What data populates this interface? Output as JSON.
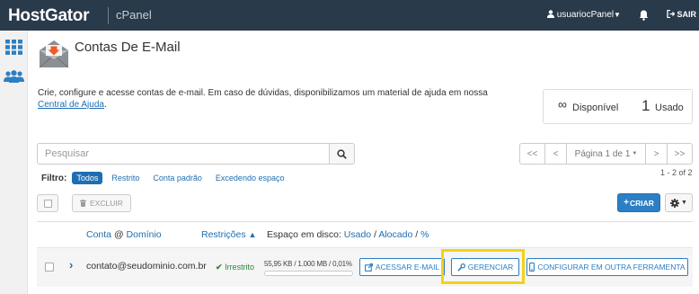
{
  "header": {
    "brand": "HostGator",
    "product": "cPanel",
    "username": "usuariocPanel",
    "logout_label": "SAIR"
  },
  "page": {
    "title": "Contas De E-Mail",
    "description": "Crie, configure e acesse contas de e-mail. Em caso de dúvidas, disponibilizamos um material de ajuda em nossa",
    "help_link": "Central de Ajuda",
    "help_suffix": "."
  },
  "stats": {
    "available_symbol": "∞",
    "available_label": "Disponível",
    "used_count": "1",
    "used_label": "Usado"
  },
  "search": {
    "placeholder": "Pesquisar"
  },
  "pagination": {
    "first": "<<",
    "prev": "<",
    "page_label": "Página 1 de 1",
    "next": ">",
    "last": ">>",
    "range": "1 - 2 of 2"
  },
  "filters": {
    "label": "Filtro:",
    "options": [
      "Todos",
      "Restrito",
      "Conta padrão",
      "Excedendo espaço"
    ],
    "active": "Todos"
  },
  "toolbar": {
    "delete_label": "EXCLUIR",
    "create_label": "CRIAR"
  },
  "table": {
    "columns": {
      "account": "Conta",
      "at": "@",
      "domain": "Domínio",
      "restrictions": "Restrições",
      "disk_prefix": "Espaço em disco:",
      "disk_used": "Usado",
      "disk_sep1": "/",
      "disk_alloc": "Alocado",
      "disk_sep2": "/",
      "disk_pct": "%"
    },
    "rows": [
      {
        "email": "contato@seudominio.com.br",
        "restriction": "Irrestrito",
        "disk": "55,95 KB / 1.000 MB / 0,01%",
        "disk_fraction": 0.0001,
        "actions": {
          "access": "ACESSAR E-MAIL",
          "manage": "GERENCIAR",
          "configure": "CONFIGURAR EM OUTRA FERRAMENTA"
        }
      }
    ]
  },
  "colors": {
    "topbar": "#293a4a",
    "accent": "#2c7fc4",
    "highlight": "#f3d11b",
    "ok": "#2e8540"
  }
}
